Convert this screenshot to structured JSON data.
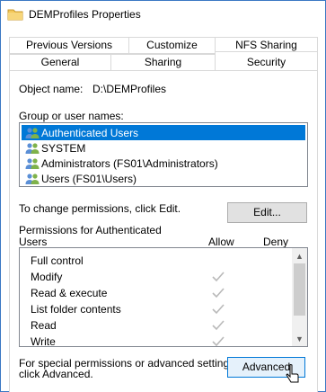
{
  "window": {
    "title": "DEMProfiles Properties"
  },
  "tabs": {
    "row1": [
      {
        "label": "Previous Versions"
      },
      {
        "label": "Customize"
      },
      {
        "label": "NFS Sharing"
      }
    ],
    "row2": [
      {
        "label": "General"
      },
      {
        "label": "Sharing"
      },
      {
        "label": "Security",
        "active": true
      }
    ]
  },
  "security": {
    "object_name_label": "Object name:",
    "object_name_value": "D:\\DEMProfiles",
    "group_label": "Group or user names:",
    "users": [
      {
        "name": "Authenticated Users",
        "selected": true
      },
      {
        "name": "SYSTEM",
        "selected": false
      },
      {
        "name": "Administrators (FS01\\Administrators)",
        "selected": false
      },
      {
        "name": "Users (FS01\\Users)",
        "selected": false
      }
    ],
    "change_hint": "To change permissions, click Edit.",
    "edit_button": "Edit...",
    "permissions_label_line1": "Permissions for Authenticated",
    "permissions_label_line2": "Users",
    "allow_header": "Allow",
    "deny_header": "Deny",
    "permissions": [
      {
        "name": "Full control",
        "allow": false
      },
      {
        "name": "Modify",
        "allow": true
      },
      {
        "name": "Read & execute",
        "allow": true
      },
      {
        "name": "List folder contents",
        "allow": true
      },
      {
        "name": "Read",
        "allow": true
      },
      {
        "name": "Write",
        "allow": true
      }
    ],
    "special_hint_line1": "For special permissions or advanced settings,",
    "special_hint_line2": "click Advanced.",
    "advanced_button": "Advanced"
  },
  "colors": {
    "selection": "#0078d7",
    "check": "#b9b9b9",
    "window_border": "#3b78c4"
  }
}
